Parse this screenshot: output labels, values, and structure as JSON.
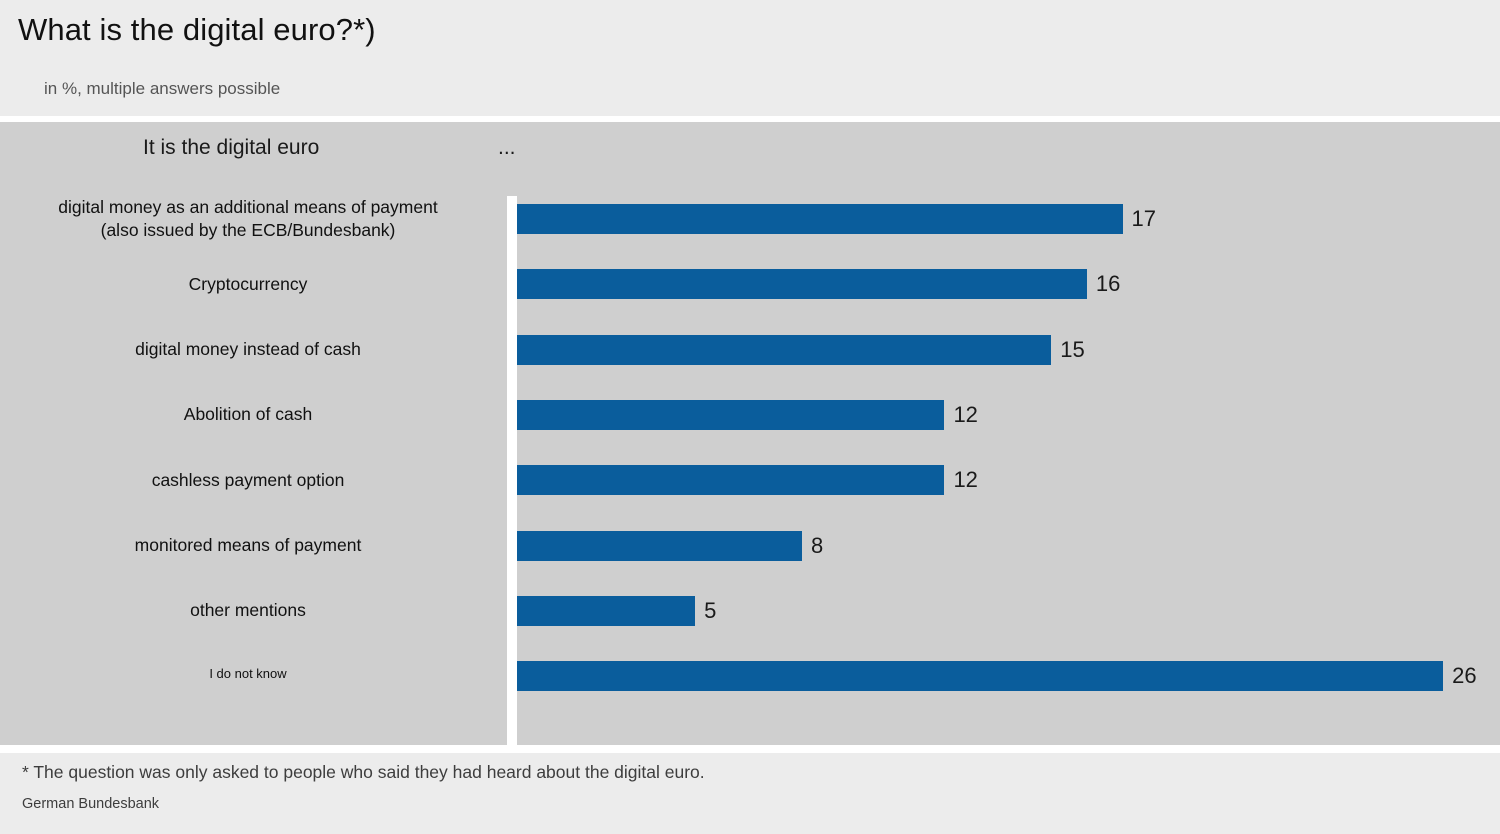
{
  "header": {
    "title": "What is the digital euro?*)",
    "subtitle": "in %, multiple answers possible"
  },
  "panel": {
    "header_label": "It is the digital euro",
    "header_ellipsis": "..."
  },
  "footer": {
    "footnote": "* The question was only asked to people who said they had heard about the digital euro.",
    "source": "German Bundesbank"
  },
  "chart_data": {
    "type": "bar",
    "orientation": "horizontal",
    "title": "What is the digital euro?*)",
    "subtitle": "in %, multiple answers possible",
    "xlabel": "",
    "ylabel": "",
    "unit": "%",
    "xlim": [
      0,
      28
    ],
    "grid": false,
    "legend": null,
    "bar_color": "#0a5d9c",
    "panel_background": "#cfcfcf",
    "header_background": "#ececec",
    "categories": [
      "digital money as an additional means of payment (also issued by the ECB/Bundesbank)",
      "Cryptocurrency",
      "digital money instead of cash",
      "Abolition of cash",
      "cashless payment option",
      "monitored means of payment",
      "other mentions",
      "I do not know"
    ],
    "values": [
      17,
      16,
      15,
      12,
      12,
      8,
      5,
      26
    ],
    "bars": [
      {
        "label_line1": "digital money as an additional means of payment",
        "label_line2": "(also issued by the ECB/Bundesbank)",
        "value": 17,
        "value_text": "17"
      },
      {
        "label_line1": "Cryptocurrency",
        "label_line2": "",
        "value": 16,
        "value_text": "16"
      },
      {
        "label_line1": "digital money instead of cash",
        "label_line2": "",
        "value": 15,
        "value_text": "15"
      },
      {
        "label_line1": "Abolition of cash",
        "label_line2": "",
        "value": 12,
        "value_text": "12"
      },
      {
        "label_line1": "cashless payment option",
        "label_line2": "",
        "value": 12,
        "value_text": "12"
      },
      {
        "label_line1": "monitored means of payment",
        "label_line2": "",
        "value": 8,
        "value_text": "8"
      },
      {
        "label_line1": "other mentions",
        "label_line2": "",
        "value": 5,
        "value_text": "5"
      },
      {
        "label_line1": "I do not know",
        "label_line2": "",
        "value": 26,
        "value_text": "26"
      }
    ],
    "annotations": [
      "It is the digital euro",
      "...",
      "* The question was only asked to people who said they had heard about the digital euro.",
      "German Bundesbank"
    ]
  }
}
